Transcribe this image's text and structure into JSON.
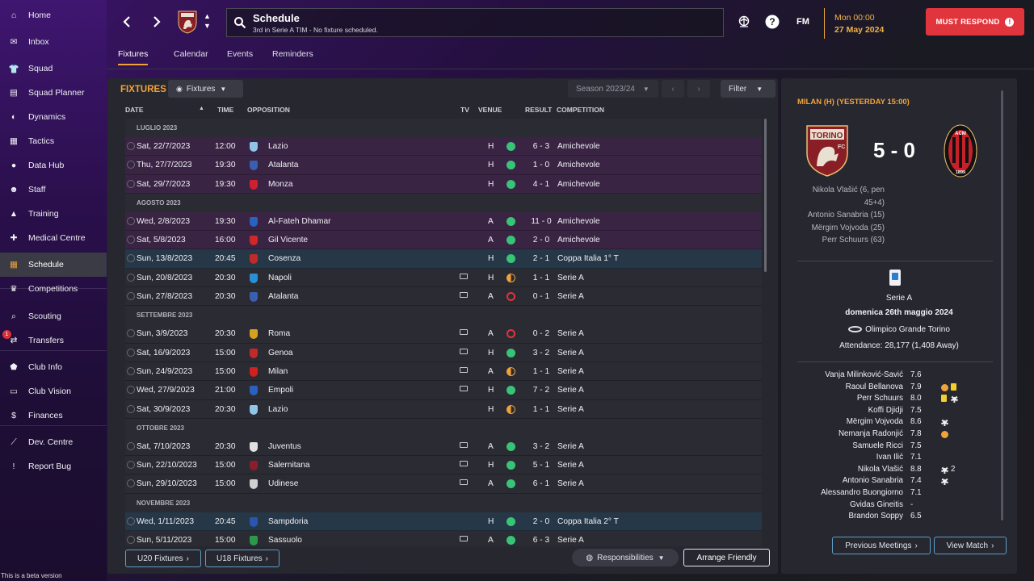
{
  "sidebar": {
    "items": [
      {
        "label": "Home",
        "icon": "home-icon"
      },
      {
        "label": "Inbox",
        "icon": "inbox-icon"
      },
      {
        "label": "Squad",
        "icon": "squad-icon"
      },
      {
        "label": "Squad Planner",
        "icon": "clipboard-icon"
      },
      {
        "label": "Dynamics",
        "icon": "dynamics-icon"
      },
      {
        "label": "Tactics",
        "icon": "tactics-icon"
      },
      {
        "label": "Data Hub",
        "icon": "data-hub-icon"
      },
      {
        "label": "Staff",
        "icon": "staff-icon"
      },
      {
        "label": "Training",
        "icon": "training-icon"
      },
      {
        "label": "Medical Centre",
        "icon": "medical-icon"
      },
      {
        "label": "Schedule",
        "icon": "calendar-icon"
      },
      {
        "label": "Competitions",
        "icon": "trophy-icon"
      },
      {
        "label": "Scouting",
        "icon": "scouting-icon"
      },
      {
        "label": "Transfers",
        "icon": "transfers-icon",
        "badge": "1"
      },
      {
        "label": "Club Info",
        "icon": "club-info-icon"
      },
      {
        "label": "Club Vision",
        "icon": "club-vision-icon"
      },
      {
        "label": "Finances",
        "icon": "finances-icon"
      },
      {
        "label": "Dev. Centre",
        "icon": "dev-centre-icon"
      },
      {
        "label": "Report Bug",
        "icon": "report-bug-icon"
      }
    ],
    "active": "Schedule",
    "beta": "This is a beta version"
  },
  "header": {
    "title": "Schedule",
    "subtitle": "3rd in Serie A TIM - No fixture scheduled.",
    "fm": "FM",
    "time": "Mon 00:00",
    "date": "27 May 2024",
    "must_respond": "MUST RESPOND"
  },
  "tabs": [
    "Fixtures",
    "Calendar",
    "Events",
    "Reminders"
  ],
  "fixtures": {
    "title": "FIXTURES",
    "view_dropdown": "Fixtures",
    "season": "Season 2023/24",
    "filter": "Filter",
    "columns": {
      "date": "DATE",
      "time": "TIME",
      "opposition": "OPPOSITION",
      "tv": "TV",
      "venue": "VENUE",
      "result": "RESULT",
      "competition": "COMPETITION"
    },
    "groups": [
      {
        "month": "LUGLIO 2023",
        "rows": [
          {
            "date": "Sat, 22/7/2023",
            "time": "12:00",
            "opp": "Lazio",
            "tv": false,
            "venue": "H",
            "res": "w",
            "score": "6 - 3",
            "comp": "Amichevole",
            "type": "pre",
            "color": "#8ec5e8"
          },
          {
            "date": "Thu, 27/7/2023",
            "time": "19:30",
            "opp": "Atalanta",
            "tv": false,
            "venue": "H",
            "res": "w",
            "score": "1 - 0",
            "comp": "Amichevole",
            "type": "pre",
            "color": "#3a5fb0"
          },
          {
            "date": "Sat, 29/7/2023",
            "time": "19:30",
            "opp": "Monza",
            "tv": false,
            "venue": "H",
            "res": "w",
            "score": "4 - 1",
            "comp": "Amichevole",
            "type": "pre",
            "color": "#d0202e"
          }
        ]
      },
      {
        "month": "AGOSTO 2023",
        "rows": [
          {
            "date": "Wed, 2/8/2023",
            "time": "19:30",
            "opp": "Al-Fateh Dhamar",
            "tv": false,
            "venue": "A",
            "res": "w",
            "score": "11 - 0",
            "comp": "Amichevole",
            "type": "pre",
            "color": "#2a62c0"
          },
          {
            "date": "Sat, 5/8/2023",
            "time": "16:00",
            "opp": "Gil Vicente",
            "tv": false,
            "venue": "A",
            "res": "w",
            "score": "2 - 0",
            "comp": "Amichevole",
            "type": "pre",
            "color": "#d02828"
          },
          {
            "date": "Sun, 13/8/2023",
            "time": "20:45",
            "opp": "Cosenza",
            "tv": false,
            "venue": "H",
            "res": "w",
            "score": "2 - 1",
            "comp": "Coppa Italia 1° T",
            "type": "cup",
            "color": "#c02a2a"
          },
          {
            "date": "Sun, 20/8/2023",
            "time": "20:30",
            "opp": "Napoli",
            "tv": true,
            "venue": "H",
            "res": "d",
            "score": "1 - 1",
            "comp": "Serie A",
            "type": "norm",
            "color": "#2b8fd6"
          },
          {
            "date": "Sun, 27/8/2023",
            "time": "20:30",
            "opp": "Atalanta",
            "tv": true,
            "venue": "A",
            "res": "l",
            "score": "0 - 1",
            "comp": "Serie A",
            "type": "norm",
            "color": "#3a5fb0"
          }
        ]
      },
      {
        "month": "SETTEMBRE 2023",
        "rows": [
          {
            "date": "Sun, 3/9/2023",
            "time": "20:30",
            "opp": "Roma",
            "tv": true,
            "venue": "A",
            "res": "l",
            "score": "0 - 2",
            "comp": "Serie A",
            "type": "norm",
            "color": "#d8a020"
          },
          {
            "date": "Sat, 16/9/2023",
            "time": "15:00",
            "opp": "Genoa",
            "tv": true,
            "venue": "H",
            "res": "w",
            "score": "3 - 2",
            "comp": "Serie A",
            "type": "norm",
            "color": "#c22a2a"
          },
          {
            "date": "Sun, 24/9/2023",
            "time": "15:00",
            "opp": "Milan",
            "tv": true,
            "venue": "A",
            "res": "d",
            "score": "1 - 1",
            "comp": "Serie A",
            "type": "norm",
            "color": "#d02020"
          },
          {
            "date": "Wed, 27/9/2023",
            "time": "21:00",
            "opp": "Empoli",
            "tv": true,
            "venue": "H",
            "res": "w",
            "score": "7 - 2",
            "comp": "Serie A",
            "type": "norm",
            "color": "#2a60c0"
          },
          {
            "date": "Sat, 30/9/2023",
            "time": "20:30",
            "opp": "Lazio",
            "tv": false,
            "venue": "H",
            "res": "d",
            "score": "1 - 1",
            "comp": "Serie A",
            "type": "norm",
            "color": "#8ec5e8"
          }
        ]
      },
      {
        "month": "OTTOBRE 2023",
        "rows": [
          {
            "date": "Sat, 7/10/2023",
            "time": "20:30",
            "opp": "Juventus",
            "tv": true,
            "venue": "A",
            "res": "w",
            "score": "3 - 2",
            "comp": "Serie A",
            "type": "norm",
            "color": "#e0e0e0"
          },
          {
            "date": "Sun, 22/10/2023",
            "time": "15:00",
            "opp": "Salernitana",
            "tv": true,
            "venue": "H",
            "res": "w",
            "score": "5 - 1",
            "comp": "Serie A",
            "type": "norm",
            "color": "#8a1e2a"
          },
          {
            "date": "Sun, 29/10/2023",
            "time": "15:00",
            "opp": "Udinese",
            "tv": true,
            "venue": "A",
            "res": "w",
            "score": "6 - 1",
            "comp": "Serie A",
            "type": "norm",
            "color": "#d0d0d0"
          }
        ]
      },
      {
        "month": "NOVEMBRE 2023",
        "rows": [
          {
            "date": "Wed, 1/11/2023",
            "time": "20:45",
            "opp": "Sampdoria",
            "tv": false,
            "venue": "H",
            "res": "w",
            "score": "2 - 0",
            "comp": "Coppa Italia 2° T",
            "type": "cup",
            "color": "#2a56b0"
          },
          {
            "date": "Sun, 5/11/2023",
            "time": "15:00",
            "opp": "Sassuolo",
            "tv": true,
            "venue": "A",
            "res": "w",
            "score": "6 - 3",
            "comp": "Serie A",
            "type": "norm",
            "color": "#2a9a4a"
          }
        ]
      }
    ],
    "buttons": {
      "u20": "U20 Fixtures",
      "u18": "U18 Fixtures",
      "responsibilities": "Responsibilities",
      "arrange": "Arrange Friendly"
    }
  },
  "match": {
    "header": "MILAN (H) (YESTERDAY 15:00)",
    "home_crest": "TORINO",
    "home_fc": "FC",
    "away_crest": "ACM",
    "away_year": "1899",
    "score": "5 - 0",
    "scorers": [
      "Nikola Vlašić (6, pen",
      "45+4)",
      "Antonio Sanabria (15)",
      "Mërgim Vojvoda (25)",
      "Perr Schuurs (63)"
    ],
    "competition": "Serie A",
    "date": "domenica 26th maggio 2024",
    "stadium": "Olimpico Grande Torino",
    "attendance": "Attendance: 28,177 (1,408 Away)",
    "players": [
      {
        "name": "Vanja Milinković-Savić",
        "rating": "7.6",
        "events": []
      },
      {
        "name": "Raoul Bellanova",
        "rating": "7.9",
        "events": [
          "assist",
          "yellow"
        ]
      },
      {
        "name": "Perr Schuurs",
        "rating": "8.0",
        "events": [
          "yellow",
          "goal"
        ]
      },
      {
        "name": "Koffi Djidji",
        "rating": "7.5",
        "events": []
      },
      {
        "name": "Mërgim Vojvoda",
        "rating": "8.6",
        "events": [
          "goal"
        ]
      },
      {
        "name": "Nemanja Radonjić",
        "rating": "7.8",
        "events": [
          "assist"
        ]
      },
      {
        "name": "Samuele Ricci",
        "rating": "7.5",
        "events": []
      },
      {
        "name": "Ivan Ilić",
        "rating": "7.1",
        "events": []
      },
      {
        "name": "Nikola Vlašić",
        "rating": "8.8",
        "events": [
          "goal"
        ],
        "goal_count": "2"
      },
      {
        "name": "Antonio Sanabria",
        "rating": "7.4",
        "events": [
          "goal"
        ]
      },
      {
        "name": "Alessandro Buongiorno",
        "rating": "7.1",
        "events": []
      },
      {
        "name": "Gvidas Gineitis",
        "rating": "-",
        "events": []
      },
      {
        "name": "Brandon Soppy",
        "rating": "6.5",
        "events": []
      }
    ],
    "prev_meetings": "Previous Meetings",
    "view_match": "View Match"
  }
}
